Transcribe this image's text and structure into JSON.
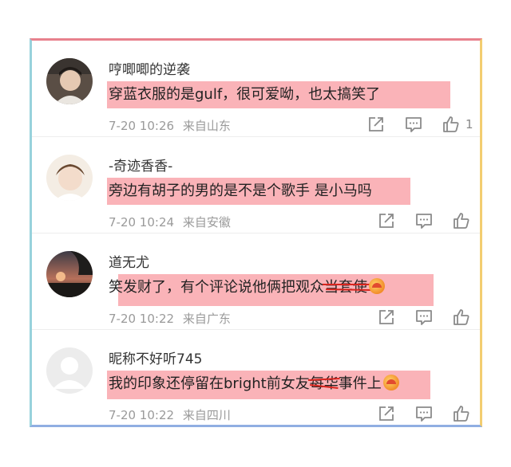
{
  "comments": [
    {
      "username": "哼唧唧的逆袭",
      "text_before": "穿蓝衣服的是gulf，很可爱呦，也太搞笑了",
      "text_strike": "",
      "text_after": "",
      "date": "7-20 10:26",
      "location": "来自山东",
      "like_count": "1"
    },
    {
      "username": "-奇迹香香-",
      "text_before": "旁边有胡子的男的是不是个歌手 是小马吗",
      "text_strike": "",
      "text_after": "",
      "date": "7-20 10:24",
      "location": "来自安徽",
      "like_count": ""
    },
    {
      "username": "道无尤",
      "text_before": "笑发财了，有个评论说他俩把观众",
      "text_strike": "当套使",
      "text_after": "",
      "date": "7-20 10:22",
      "location": "来自广东",
      "like_count": ""
    },
    {
      "username": "昵称不好听745",
      "text_before": "我的印象还停留在bright前女友",
      "text_strike": "每华",
      "text_after": "事件上",
      "date": "7-20 10:22",
      "location": "来自四川",
      "like_count": ""
    }
  ],
  "icons": {
    "share": "share-icon",
    "comment": "comment-icon",
    "like": "thumbs-up-icon",
    "emoji": "laughing-emoji-icon"
  },
  "colors": {
    "highlight": "#f8969c",
    "frame_top": "#e8818d",
    "frame_right": "#f3cd70",
    "frame_bottom": "#90aee2",
    "frame_left": "#98d2dc",
    "strike_marks": "#d8241d"
  }
}
